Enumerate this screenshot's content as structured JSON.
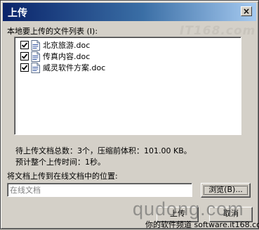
{
  "dialog": {
    "title": "上传",
    "close_glyph": "×"
  },
  "file_list": {
    "label": "本地要上传的文件列表 (I):",
    "items": [
      {
        "name": "北京旅游.doc",
        "checked": true,
        "icon": "word-doc-icon"
      },
      {
        "name": "传真内容.doc",
        "checked": true,
        "icon": "word-doc-icon"
      },
      {
        "name": "威灵软件方案.doc",
        "checked": true,
        "icon": "word-doc-icon"
      }
    ]
  },
  "summary": {
    "line1": "待上传文档总数：3个，压缩前体积：101.00 KB。",
    "line2": "预计整个上传时间：1秒。"
  },
  "location": {
    "label": "将文档上传到在线文档中的位置:",
    "value": "在线文档",
    "browse_label": "浏览(B)..."
  },
  "buttons": {
    "upload_label": "上传",
    "cancel_label": "取消"
  },
  "watermarks": {
    "top": "IT168.com",
    "qudong": "qudong.com",
    "site": "你的软件频道 software.it168.com"
  },
  "colors": {
    "titlebar_start": "#0a246a",
    "titlebar_end": "#a6caf0",
    "face": "#d4d0c8"
  }
}
